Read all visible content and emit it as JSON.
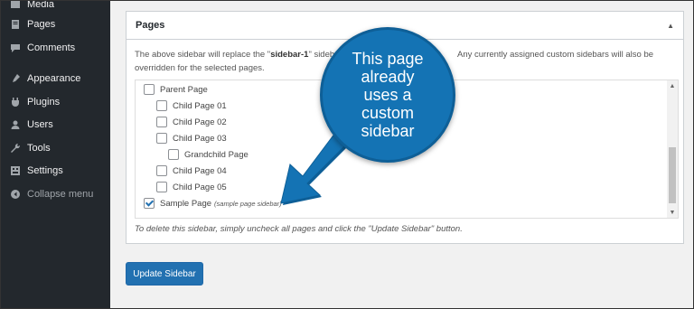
{
  "nav": {
    "items": [
      {
        "label": "Media",
        "icon": "media-icon"
      },
      {
        "label": "Pages",
        "icon": "pages-icon"
      },
      {
        "label": "Comments",
        "icon": "comments-icon"
      },
      {
        "label": "Appearance",
        "icon": "appearance-icon"
      },
      {
        "label": "Plugins",
        "icon": "plugins-icon"
      },
      {
        "label": "Users",
        "icon": "users-icon"
      },
      {
        "label": "Tools",
        "icon": "tools-icon"
      },
      {
        "label": "Settings",
        "icon": "settings-icon"
      },
      {
        "label": "Collapse menu",
        "icon": "collapse-icon"
      }
    ]
  },
  "panel": {
    "title": "Pages",
    "desc_pre": "The above sidebar will replace the \"",
    "desc_bold": "sidebar-1",
    "desc_post": "\" sideb",
    "desc_right": "Any currently assigned custom sidebars will also be",
    "desc_line2": "overridden for the selected pages.",
    "footnote": "To delete this sidebar, simply uncheck all pages and click the \"Update Sidebar\" button."
  },
  "pages": [
    {
      "label": "Parent Page",
      "checked": false
    },
    {
      "label": "Child Page 01",
      "checked": false
    },
    {
      "label": "Child Page 02",
      "checked": false
    },
    {
      "label": "Child Page 03",
      "checked": false
    },
    {
      "label": "Grandchild Page",
      "checked": false
    },
    {
      "label": "Child Page 04",
      "checked": false
    },
    {
      "label": "Child Page 05",
      "checked": false
    },
    {
      "label": "Sample Page",
      "note": "(sample page sidebar)",
      "checked": true
    }
  ],
  "update_button": "Update Sidebar",
  "callout": "This page already uses a custom sidebar",
  "colors": {
    "accent": "#2271b1",
    "callout": "#1473b4",
    "sidebar": "#23282d"
  }
}
